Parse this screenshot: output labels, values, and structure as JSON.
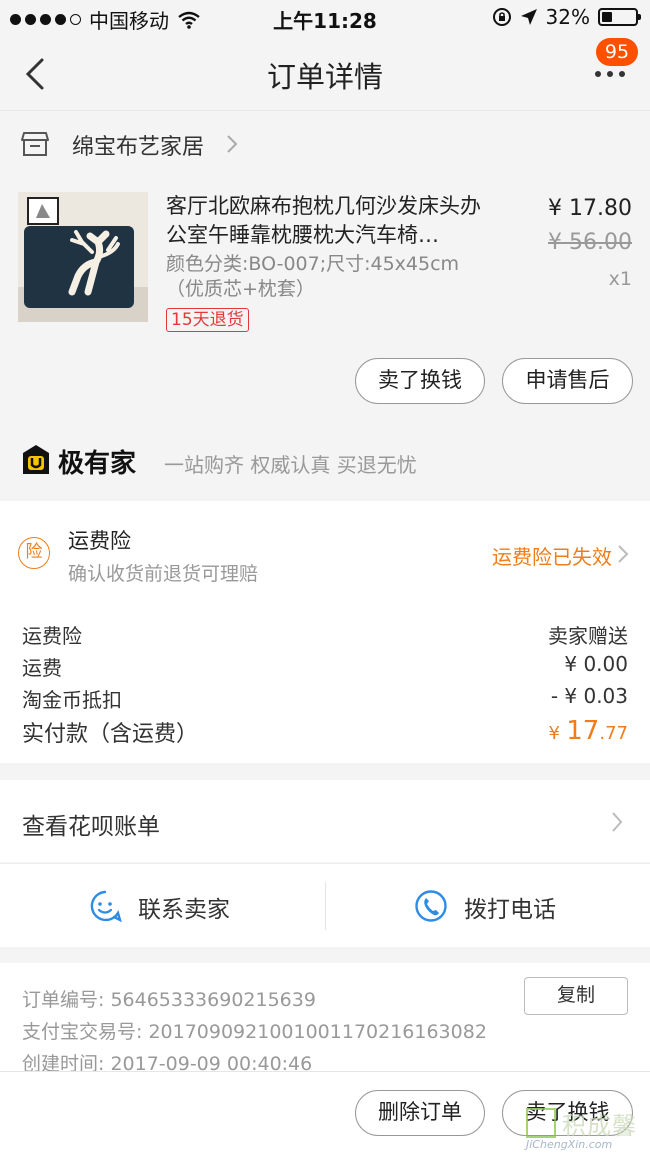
{
  "status_bar": {
    "carrier": "中国移动",
    "time": "上午11:28",
    "battery": "32%"
  },
  "nav": {
    "title": "订单详情",
    "badge": "95"
  },
  "shop": {
    "name": "绵宝布艺家居"
  },
  "item": {
    "title": "客厅北欧麻布抱枕几何沙发床头办公室午睡靠枕腰枕大汽车椅…",
    "spec": "颜色分类:BO-007;尺寸:45x45cm（优质芯+枕套）",
    "tag": "15天退货",
    "price": "¥ 17.80",
    "original_price": "¥ 56.00",
    "quantity": "x1",
    "btn_sell": "卖了换钱",
    "btn_after_sale": "申请售后"
  },
  "jiyoujia": {
    "brand": "极有家",
    "slogan": "一站购齐 权威认真 买退无忧"
  },
  "insurance": {
    "icon_text": "险",
    "title": "运费险",
    "subtitle": "确认收货前退货可理赔",
    "status": "运费险已失效"
  },
  "costs": {
    "rows": [
      {
        "label": "运费险",
        "value": "卖家赠送"
      },
      {
        "label": "运费",
        "value": "¥ 0.00"
      },
      {
        "label": "淘金币抵扣",
        "value": "- ¥ 0.03"
      }
    ],
    "total_label": "实付款（含运费）",
    "total_currency": "¥",
    "total_int": "17",
    "total_dec": ".77"
  },
  "huabei": {
    "label": "查看花呗账单"
  },
  "contact": {
    "seller": "联系卖家",
    "call": "拨打电话"
  },
  "order_meta": {
    "order_no": "订单编号:   56465333690215639",
    "alipay_no": "支付宝交易号:   2017090921001001170216163082",
    "created": "创建时间:   2017-09-09 00:40:46",
    "copy": "复制"
  },
  "bottom": {
    "delete": "删除订单",
    "sell": "卖了换钱"
  },
  "watermark": {
    "cn": "积成馨",
    "en": "JiChengXin.com"
  },
  "colors": {
    "accent": "#ff5000",
    "orange": "#f07d1a",
    "blue": "#2d8ce6",
    "tag_red": "#e4393c"
  }
}
